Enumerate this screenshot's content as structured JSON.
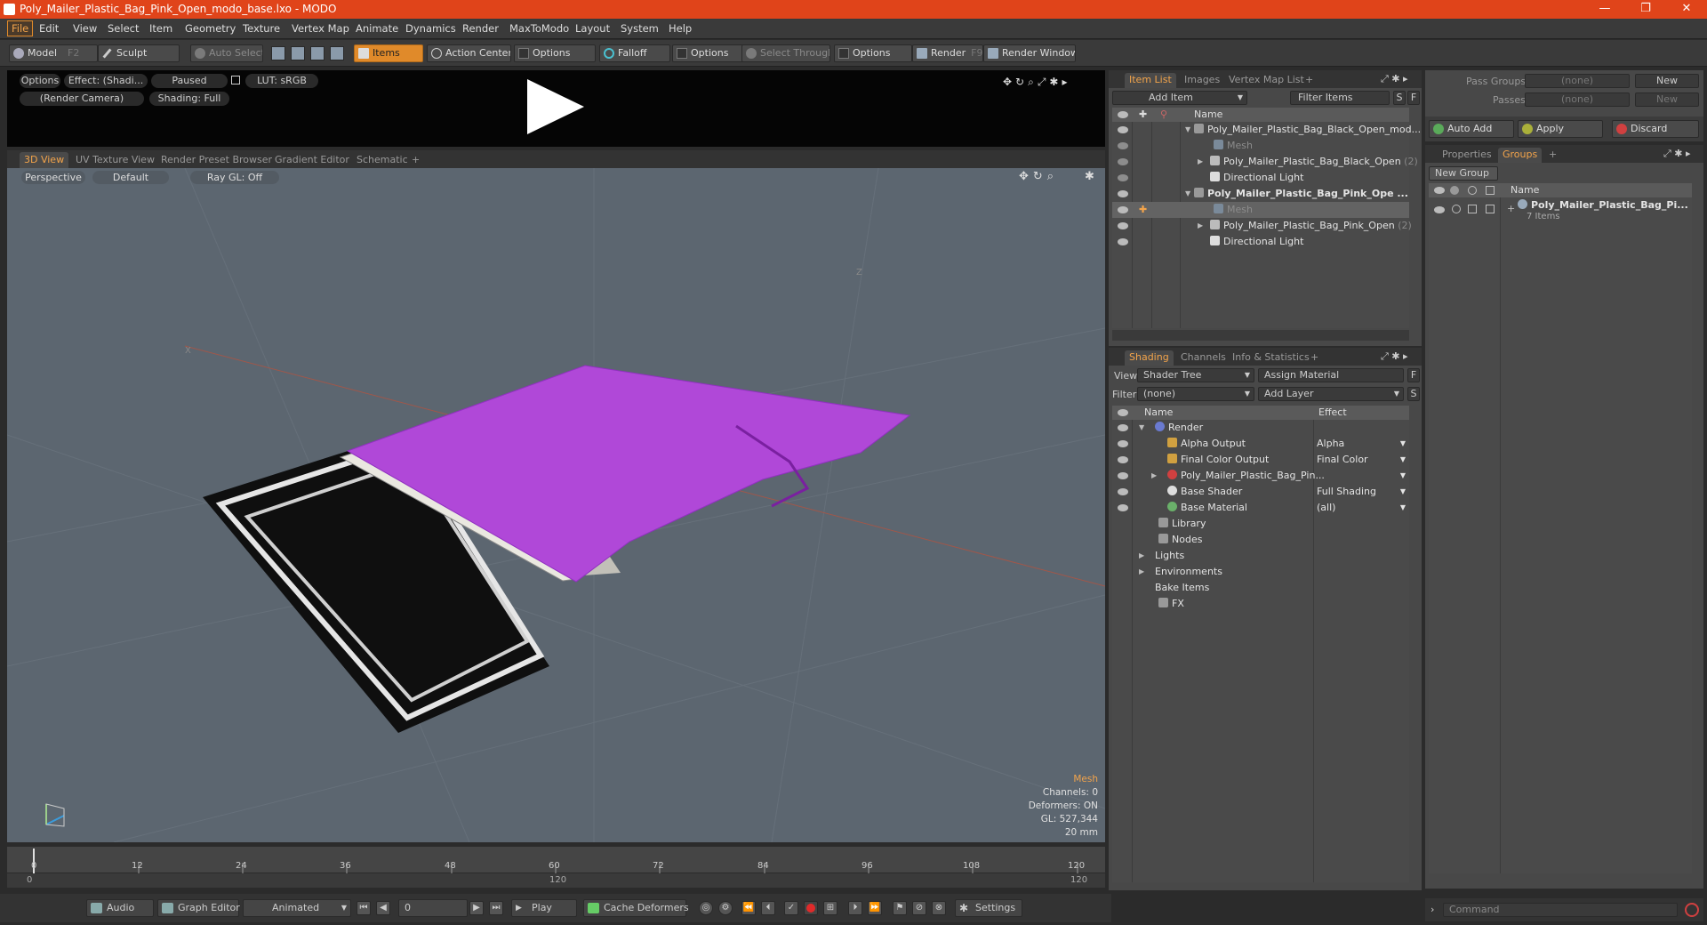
{
  "window": {
    "title": "Poly_Mailer_Plastic_Bag_Pink_Open_modo_base.lxo - MODO",
    "minimize": "—",
    "restore": "❐",
    "close": "✕"
  },
  "menu": [
    "File",
    "Edit",
    "View",
    "Select",
    "Item",
    "Geometry",
    "Texture",
    "Vertex Map",
    "Animate",
    "Dynamics",
    "Render",
    "MaxToModo",
    "Layout",
    "System",
    "Help"
  ],
  "toolbar": {
    "model": "Model",
    "model_key": "F2",
    "sculpt": "Sculpt",
    "auto_select": "Auto Select",
    "items": "Items",
    "action_center": "Action Center",
    "options1": "Options",
    "falloff": "Falloff",
    "options2": "Options",
    "select_through": "Select Through",
    "options3": "Options",
    "render": "Render",
    "render_key": "F9",
    "render_window": "Render Window"
  },
  "preview": {
    "options": "Options",
    "effect": "Effect: (Shadi...",
    "paused": "Paused",
    "lut": "LUT: sRGB",
    "camera": "(Render Camera)",
    "shading": "Shading: Full"
  },
  "view_tabs": [
    "3D View",
    "UV Texture View",
    "Render Preset Browser",
    "Gradient Editor",
    "Schematic",
    "+"
  ],
  "viewport": {
    "perspective": "Perspective",
    "default": "Default",
    "raygl": "Ray GL: Off",
    "info_title": "Mesh",
    "channels": "Channels: 0",
    "deformers": "Deformers: ON",
    "gl": "GL: 527,344",
    "scale": "20 mm",
    "axis_x": "X",
    "axis_z": "Z"
  },
  "timeline": {
    "ticks": [
      "0",
      "12",
      "24",
      "36",
      "48",
      "60",
      "72",
      "84",
      "96",
      "108",
      "120"
    ],
    "start": "0",
    "mid": "120",
    "end": "120",
    "end2": "120"
  },
  "bottom": {
    "audio": "Audio",
    "graph_editor": "Graph Editor",
    "animated": "Animated",
    "frame": "0",
    "play": "Play",
    "cache_deformers": "Cache Deformers",
    "settings": "Settings"
  },
  "item_list": {
    "tabs": [
      "Item List",
      "Images",
      "Vertex Map List",
      "+"
    ],
    "add_item": "Add Item",
    "filter_items": "Filter Items",
    "s": "S",
    "f": "F",
    "col_name": "Name",
    "rows": [
      {
        "label": "Poly_Mailer_Plastic_Bag_Black_Open_mod...",
        "indent": 0,
        "style": "normal"
      },
      {
        "label": "Mesh",
        "indent": 1,
        "style": "dim"
      },
      {
        "label": "Poly_Mailer_Plastic_Bag_Black_Open",
        "count": "(2)",
        "indent": 1,
        "style": "normal"
      },
      {
        "label": "Directional Light",
        "indent": 1,
        "style": "normal"
      },
      {
        "label": "Poly_Mailer_Plastic_Bag_Pink_Ope ...",
        "indent": 0,
        "style": "bold"
      },
      {
        "label": "Mesh",
        "indent": 1,
        "style": "sel"
      },
      {
        "label": "Poly_Mailer_Plastic_Bag_Pink_Open",
        "count": "(2)",
        "indent": 1,
        "style": "normal"
      },
      {
        "label": "Directional Light",
        "indent": 1,
        "style": "normal"
      }
    ]
  },
  "shading": {
    "tabs": [
      "Shading",
      "Channels",
      "Info & Statistics",
      "+"
    ],
    "view_label": "View",
    "view_value": "Shader Tree",
    "assign_material": "Assign Material",
    "filter_label": "Filter",
    "filter_value": "(none)",
    "add_layer": "Add Layer",
    "f": "F",
    "s": "S",
    "col_name": "Name",
    "col_effect": "Effect",
    "rows": [
      {
        "label": "Render",
        "effect": "",
        "indent": 0
      },
      {
        "label": "Alpha Output",
        "effect": "Alpha",
        "indent": 1
      },
      {
        "label": "Final Color Output",
        "effect": "Final Color",
        "indent": 1
      },
      {
        "label": "Poly_Mailer_Plastic_Bag_Pin...",
        "effect": "",
        "indent": 1
      },
      {
        "label": "Base Shader",
        "effect": "Full Shading",
        "indent": 1
      },
      {
        "label": "Base Material",
        "effect": "(all)",
        "indent": 1
      },
      {
        "label": "Library",
        "effect": "",
        "indent": 0
      },
      {
        "label": "Nodes",
        "effect": "",
        "indent": 0
      },
      {
        "label": "Lights",
        "effect": "",
        "indent": -1
      },
      {
        "label": "Environments",
        "effect": "",
        "indent": -1
      },
      {
        "label": "Bake Items",
        "effect": "",
        "indent": -1
      },
      {
        "label": "FX",
        "effect": "",
        "indent": -1
      }
    ]
  },
  "right": {
    "pass_groups": "Pass Groups",
    "pass_none": "(none)",
    "new1": "New",
    "passes": "Passes",
    "passes_none": "(none)",
    "new2": "New",
    "auto_add": "Auto Add",
    "apply": "Apply",
    "discard": "Discard",
    "tabs": [
      "Properties",
      "Groups",
      "+"
    ],
    "new_group": "New Group",
    "col_name": "Name",
    "group_name": "Poly_Mailer_Plastic_Bag_Pi...",
    "group_items": "7 Items",
    "command": "Command"
  },
  "colors": {
    "title_orange": "#e0441a",
    "accent": "#f3a44b",
    "pink": "#b048d8"
  }
}
